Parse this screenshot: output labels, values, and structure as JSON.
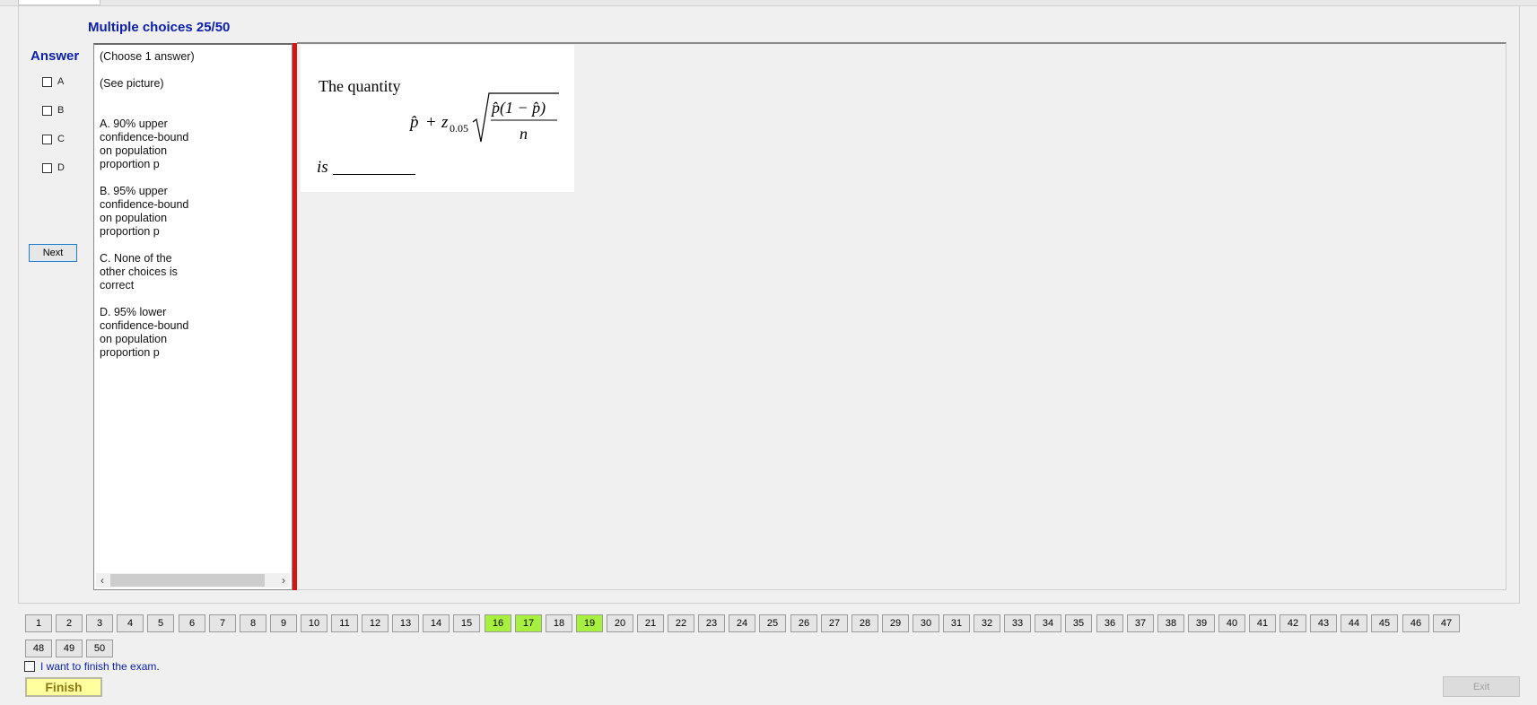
{
  "header": {
    "title": "Multiple choices 25/50"
  },
  "answer": {
    "label": "Answer",
    "options": [
      "A",
      "B",
      "C",
      "D"
    ],
    "next_label": "Next"
  },
  "question": {
    "instruction": "(Choose 1 answer)",
    "see_picture": "(See picture)",
    "choices": [
      "A.  90% upper confidence-bound on population proportion p",
      "B.  95% upper confidence-bound on population proportion p",
      "C.  None of the other choices is correct",
      "D.  95% lower confidence-bound on population proportion p"
    ]
  },
  "picture": {
    "intro": "The quantity",
    "phat": "p̂",
    "plus": "+",
    "z": "z",
    "z_sub": "0.05",
    "numerator": "p̂(1 − p̂)",
    "denominator": "n",
    "is": "is"
  },
  "question_nav": {
    "numbers": [
      "1",
      "2",
      "3",
      "4",
      "5",
      "6",
      "7",
      "8",
      "9",
      "10",
      "11",
      "12",
      "13",
      "14",
      "15",
      "16",
      "17",
      "18",
      "19",
      "20",
      "21",
      "22",
      "23",
      "24",
      "25",
      "26",
      "27",
      "28",
      "29",
      "30",
      "31",
      "32",
      "33",
      "34",
      "35",
      "36",
      "37",
      "38",
      "39",
      "40",
      "41",
      "42",
      "43",
      "44",
      "45",
      "46",
      "47",
      "48",
      "49",
      "50"
    ],
    "answered": [
      "16",
      "17",
      "19"
    ],
    "answered_color": "#a8f040"
  },
  "footer": {
    "finish_check_label": "I want to finish the exam.",
    "finish_label": "Finish",
    "exit_label": "Exit"
  }
}
